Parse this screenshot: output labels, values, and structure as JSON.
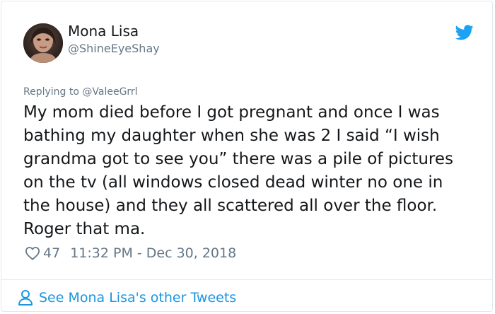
{
  "author": {
    "name": "Mona Lisa",
    "handle": "@ShineEyeShay",
    "avatar_icon": "avatar-photo"
  },
  "reply_to": "Replying to @ValeeGrrl",
  "tweet_text": "My mom died before I got pregnant and once I was\nbathing my daughter when she was 2 I said “I wish\ngrandma got to see you” there was a pile of pictures\non the tv (all windows closed dead winter no one in\nthe house) and they all scattered all over the floor.\nRoger that ma.",
  "likes": "47",
  "timestamp": "11:32 PM - Dec 30, 2018",
  "footer_link": "See Mona Lisa's other Tweets",
  "colors": {
    "twitter_blue": "#1da1f2",
    "link_blue": "#1b95e0",
    "muted_gray": "#657786",
    "text": "#14171a",
    "border": "#e1e8ed"
  },
  "icons": [
    "twitter-bird-icon",
    "heart-icon",
    "person-icon"
  ]
}
